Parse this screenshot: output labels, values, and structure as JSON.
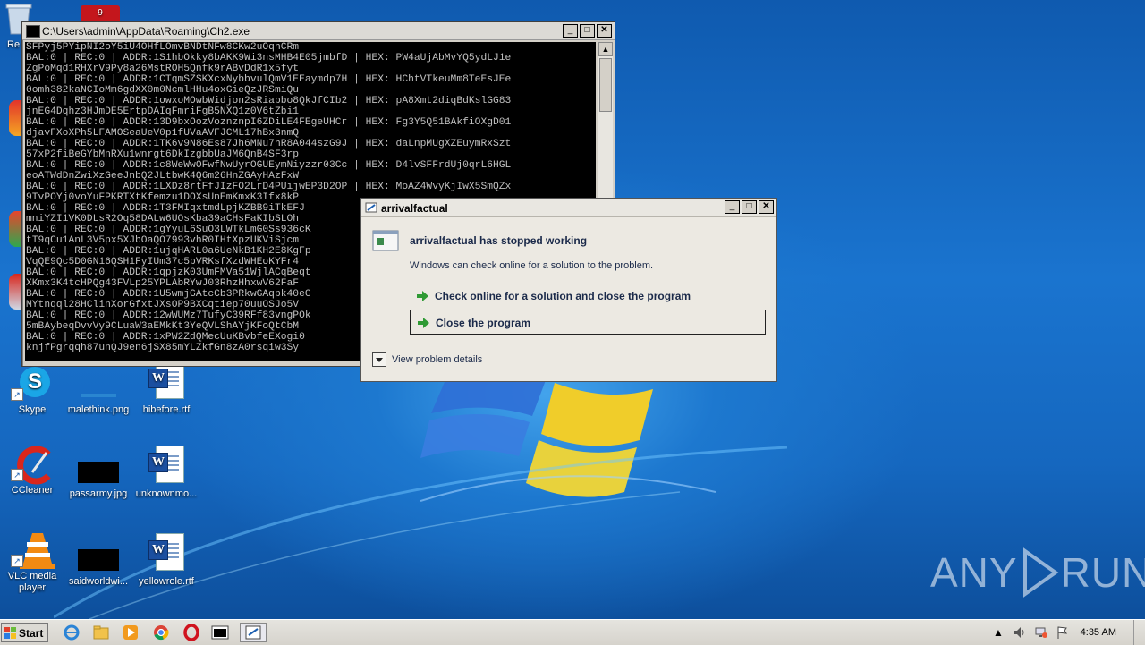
{
  "console": {
    "title": "C:\\Users\\admin\\AppData\\Roaming\\Ch2.exe",
    "lines": [
      "SFPyj5PYipNI2oY5iU4OHfLOmvBNDtNFw8CKw2uOqhCRm",
      "BAL:0 | REC:0 | ADDR:1S1hbOkky8bAKK9Wi3nsMHB4E05jmbfD | HEX: PW4aUjAbMvYQ5ydLJ1e",
      "ZgPoMqd1RHXrV9Py8a26MstROH5Qnfk9rABvDdR1x5fyt",
      "BAL:0 | REC:0 | ADDR:1CTqmSZSKXcxNybbvulQmV1EEaymdp7H | HEX: HChtVTkeuMm8TeEsJEe",
      "0omh382kaNCIoMm6gdXX0m0NcmlHHu4oxGieQzJRSmiQu",
      "BAL:0 | REC:0 | ADDR:1owxoMOwbWidjon2sRiabbo8QkJfCIb2 | HEX: pA8Xmt2diqBdKslGG83",
      "jnEG4Dqhz3HJmDE5ErtpDAIqFmriFgB5NXQ1z0V6tZbi1",
      "BAL:0 | REC:0 | ADDR:13D9bxOozVoznznpI6ZDiLE4FEgeUHCr | HEX: Fg3Y5Q51BAkfiOXgD01",
      "djavFXoXPh5LFAMOSeaUeV0p1fUVaAVFJCML17hBx3nmQ",
      "BAL:0 | REC:0 | ADDR:1TK6v9N86Es87Jh6MNu7hR8A044szG9J | HEX: daLnpMUgXZEuymRxSzt",
      "57xP2fiBeGYbMnRXu1wnrgt6DkIzgbbUaJM6QnB4SF3rp",
      "BAL:0 | REC:0 | ADDR:1c8WeWwOFwfNwUyrOGUEymNiyzzr03Cc | HEX: D4lvSFFrdUj0qrL6HGL",
      "eoATWdDnZwiXzGeeJnbQ2JLtbwK4Q6m26HnZGAyHAzFxW",
      "BAL:0 | REC:0 | ADDR:1LXDz8rtFfJIzFO2LrD4PUijwEP3D2OP | HEX: MoAZ4WvyKjIwX5SmQZx",
      "9TvPOYj0voYuFPKRTXtKfemzu1DOXsUnEmKmxK3Ifx8kP",
      "BAL:0 | REC:0 | ADDR:1T3FMIqxtmdLpjKZBB9iTkEFJ",
      "mniYZI1VK0DLsR2Oq58DALw6UOsKba39aCHsFaKIbSLOh",
      "BAL:0 | REC:0 | ADDR:1gYyuL6SuO3LWTkLmG0Ss936cK",
      "tT9qCu1AnL3V5px5XJbOaQO7993vhR0IHtXpzUKViSjcm",
      "BAL:0 | REC:0 | ADDR:1ujqHARL0a6UeNkB1KH2E8KgFp",
      "VqQE9Qc5D0GN16QSH1FyIUm37c5bVRKsfXzdWHEoKYFr4",
      "BAL:0 | REC:0 | ADDR:1qpjzK03UmFMVa51WjlACqBeqt",
      "XKmx3K4tcHPQg43FVLp25YPLAbRYwJ03RhzHhxwV62FaF",
      "BAL:0 | REC:0 | ADDR:1U5wmjGAtcCb3PRkwGAqpk40eG",
      "MYtnqql28HClinXorGfxtJXsOP9BXCqtiep70uuOSJo5V",
      "BAL:0 | REC:0 | ADDR:12wWUMz7TufyC39RFf83vngPOk",
      "5mBAybeqDvvVy9CLuaW3aEMkKt3YeQVLShAYjKFoQtCbM",
      "BAL:0 | REC:0 | ADDR:1xPW2ZdQMecUuKBvbfeEXogi0",
      "knjfPgrqqh87unQJ9en6jSX85mYLZkfGn8zA0rsqiw3Sy"
    ]
  },
  "dialog": {
    "title": "arrivalfactual",
    "heading": "arrivalfactual has stopped working",
    "message": "Windows can check online for a solution to the problem.",
    "option_check": "Check online for a solution and close the program",
    "option_close": "Close the program",
    "details": "View problem details"
  },
  "desktop_icons": [
    {
      "label": "Skype"
    },
    {
      "label": "malethink.png"
    },
    {
      "label": "hibefore.rtf"
    },
    {
      "label": "CCleaner"
    },
    {
      "label": "passarmy.jpg"
    },
    {
      "label": "unknownmo..."
    },
    {
      "label": "VLC media player"
    },
    {
      "label": "saidworldwi..."
    },
    {
      "label": "yellowrole.rtf"
    },
    {
      "label": "Re"
    }
  ],
  "watermark": {
    "left": "ANY",
    "right": "RUN"
  },
  "taskbar": {
    "start_label": "Start",
    "clock": "4:35 AM"
  },
  "colors": {
    "desktop": "#1a6fc7",
    "console_bg": "#000000",
    "console_text": "#c0c0c0",
    "dialog_bg": "#ece9e2"
  }
}
